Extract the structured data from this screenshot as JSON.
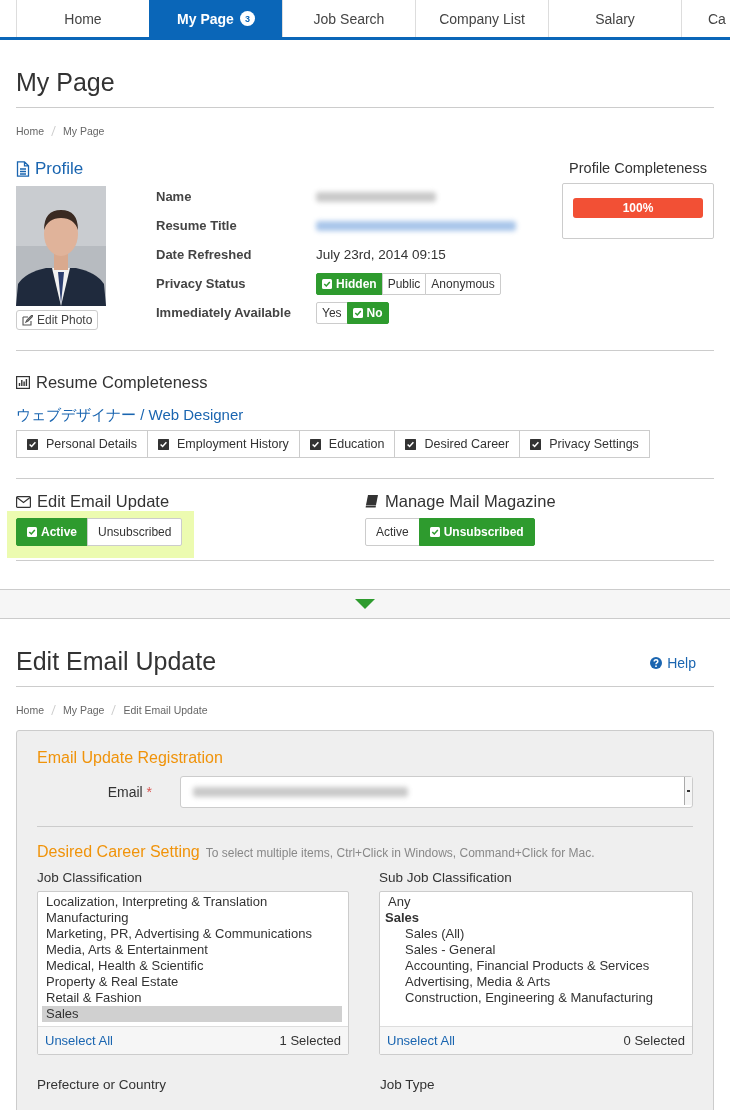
{
  "nav": {
    "tabs": [
      {
        "label": "Home",
        "selected": false
      },
      {
        "label": "My Page",
        "selected": true,
        "badge": "3"
      },
      {
        "label": "Job Search",
        "selected": false
      },
      {
        "label": "Company List",
        "selected": false
      },
      {
        "label": "Salary",
        "selected": false
      },
      {
        "label": "Ca",
        "selected": false
      }
    ]
  },
  "page": {
    "title": "My Page",
    "breadcrumb": [
      "Home",
      "My Page"
    ]
  },
  "profile": {
    "heading": "Profile",
    "edit_photo": "Edit Photo",
    "fields": [
      {
        "label": "Name",
        "kind": "redacted"
      },
      {
        "label": "Resume Title",
        "kind": "redacted_link"
      },
      {
        "label": "Date Refreshed",
        "kind": "text",
        "value": "July 23rd, 2014 09:15"
      },
      {
        "label": "Privacy Status",
        "kind": "options",
        "options": [
          {
            "label": "Hidden",
            "selected": true
          },
          {
            "label": "Public",
            "selected": false
          },
          {
            "label": "Anonymous",
            "selected": false
          }
        ]
      },
      {
        "label": "Immediately Available",
        "kind": "options",
        "options": [
          {
            "label": "Yes",
            "selected": false
          },
          {
            "label": "No",
            "selected": true
          }
        ]
      }
    ],
    "completeness": {
      "title": "Profile Completeness",
      "level": 1,
      "reading": "100%"
    }
  },
  "resume": {
    "heading": "Resume Completeness",
    "title": "ウェブデザイナー / Web Designer",
    "items": [
      {
        "label": "Personal Details",
        "checked": true
      },
      {
        "label": "Employment History",
        "checked": true
      },
      {
        "label": "Education",
        "checked": true
      },
      {
        "label": "Desired Career",
        "checked": true
      },
      {
        "label": "Privacy Settings",
        "checked": true
      }
    ]
  },
  "subscriptions": [
    {
      "heading": "Edit Email Update",
      "kind": "email",
      "highlighted": true,
      "options": [
        {
          "label": "Active",
          "selected": true
        },
        {
          "label": "Unsubscribed",
          "selected": false
        }
      ]
    },
    {
      "heading": "Manage Mail Magazine",
      "kind": "magazine",
      "highlighted": false,
      "options": [
        {
          "label": "Active",
          "selected": false
        },
        {
          "label": "Unsubscribed",
          "selected": true
        }
      ]
    }
  ],
  "form_page": {
    "title": "Edit Email Update",
    "help": "Help",
    "breadcrumb": [
      "Home",
      "My Page",
      "Edit Email Update"
    ],
    "registration": {
      "heading": "Email Update Registration",
      "email_label": "Email",
      "required": "*"
    },
    "career": {
      "heading": "Desired Career Setting",
      "hint": "To select multiple items, Ctrl+Click in Windows, Command+Click for Mac.",
      "lists": [
        {
          "label": "Job Classification",
          "unselect": "Unselect All",
          "count": "1 Selected",
          "items": [
            {
              "text": "Localization, Interpreting & Translation",
              "kind": "item",
              "selected": false
            },
            {
              "text": "Manufacturing",
              "kind": "item",
              "selected": false
            },
            {
              "text": "Marketing, PR, Advertising & Communications",
              "kind": "item",
              "selected": false
            },
            {
              "text": "Media, Arts & Entertainment",
              "kind": "item",
              "selected": false
            },
            {
              "text": "Medical, Health & Scientific",
              "kind": "item",
              "selected": false
            },
            {
              "text": "Property & Real Estate",
              "kind": "item",
              "selected": false
            },
            {
              "text": "Retail & Fashion",
              "kind": "item",
              "selected": false
            },
            {
              "text": "Sales",
              "kind": "item",
              "selected": true
            }
          ]
        },
        {
          "label": "Sub Job Classification",
          "unselect": "Unselect All",
          "count": "0 Selected",
          "items": [
            {
              "text": "Any",
              "kind": "item",
              "selected": false
            },
            {
              "text": "Sales",
              "kind": "group",
              "selected": false
            },
            {
              "text": "Sales (All)",
              "kind": "sub",
              "selected": false
            },
            {
              "text": "Sales - General",
              "kind": "sub",
              "selected": false
            },
            {
              "text": "Accounting, Financial Products & Services",
              "kind": "sub",
              "selected": false
            },
            {
              "text": "Advertising, Media & Arts",
              "kind": "sub",
              "selected": false
            },
            {
              "text": "Construction, Engineering & Manufacturing",
              "kind": "sub",
              "selected": false
            }
          ]
        }
      ],
      "next_labels": [
        "Prefecture or Country",
        "Job Type"
      ]
    }
  }
}
